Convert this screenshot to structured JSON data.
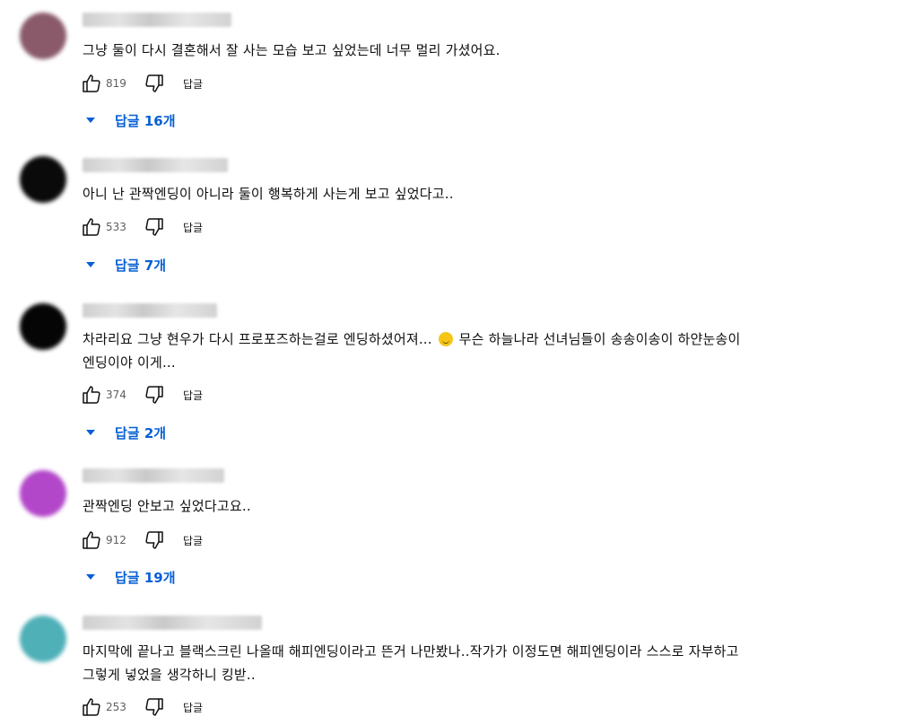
{
  "ui": {
    "reply_label": "답글",
    "accent_color": "#065fd4"
  },
  "comments": [
    {
      "avatar_color": "#8a5a6a",
      "text": "그냥 둘이 다시 결혼해서 잘 사는 모습 보고 싶었는데 너무 멀리 가셨어요.",
      "likes": "819",
      "replies_label": "답글 16개"
    },
    {
      "avatar_color": "#0a0a0a",
      "text": "아니 난 관짝엔딩이 아니라 둘이 행복하게 사는게 보고 싶었다고..",
      "likes": "533",
      "replies_label": "답글 7개"
    },
    {
      "avatar_color": "#050505",
      "text_before_emoji": "차라리요 그냥 현우가 다시 프로포즈하는걸로 엔딩하셨어져... ",
      "emoji": "slightly-smiling-face",
      "text_after_emoji": " 무슨 하늘나라 선녀님들이 송송이송이 하얀눈송이",
      "text_line2": "엔딩이야 이게...",
      "likes": "374",
      "replies_label": "답글 2개"
    },
    {
      "avatar_color": "#b347c9",
      "text": "관짝엔딩 안보고 싶었다고요..",
      "likes": "912",
      "replies_label": "답글 19개"
    },
    {
      "avatar_color": "#4fb0b8",
      "text": "마지막에 끝나고 블랙스크린 나올때 해피엔딩이라고 뜬거 나만봤나..작가가 이정도면 해피엔딩이라 스스로 자부하고\n그렇게 넣었을 생각하니 킹받..",
      "likes": "253"
    }
  ]
}
